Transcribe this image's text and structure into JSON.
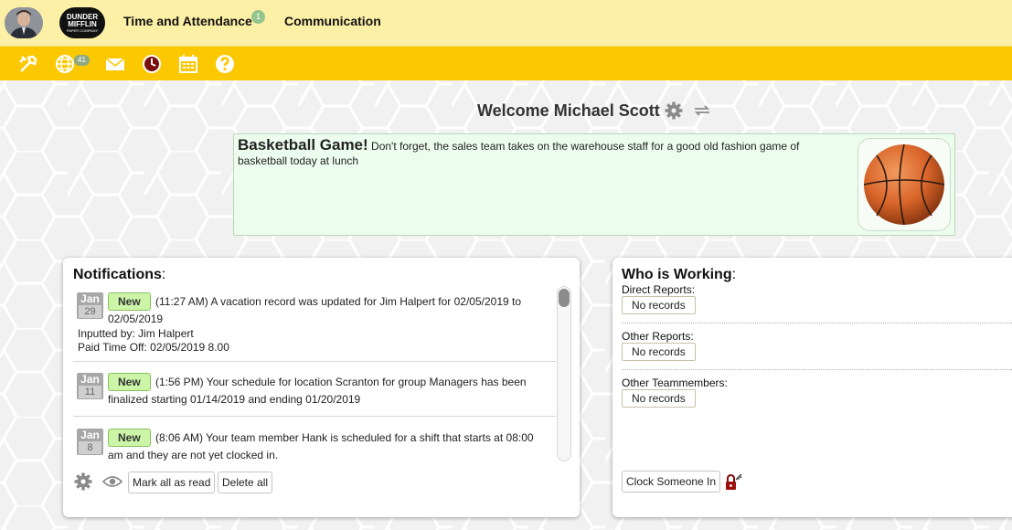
{
  "header": {
    "nav": [
      {
        "label": "Time and Attendance",
        "badge": "1"
      },
      {
        "label": "Communication"
      }
    ],
    "logo_text": [
      "DUNDER",
      "MIFFLIN",
      "PAPER COMPANY"
    ]
  },
  "toolbar": {
    "globe_badge": "41",
    "icons": [
      "wrench-icon",
      "globe-icon",
      "mail-icon",
      "clock-icon",
      "calendar-icon",
      "help-icon"
    ]
  },
  "welcome": {
    "text": "Welcome Michael Scott"
  },
  "announcement": {
    "title": "Basketball Game!",
    "body": " Don't forget, the sales team takes on the warehouse staff for a good old fashion game of basketball today at lunch"
  },
  "notifications": {
    "title": "Notifications",
    "colon": ":",
    "items": [
      {
        "month": "Jan",
        "day": "29",
        "status": "New",
        "line1": "(11:27 AM) A vacation record was updated for Jim Halpert for 02/05/2019 to",
        "line2": "02/05/2019",
        "extra1": "Inputted by: Jim Halpert",
        "extra2": "Paid Time Off: 02/05/2019 8.00"
      },
      {
        "month": "Jan",
        "day": "11",
        "status": "New",
        "line1": "(1:56 PM) Your schedule for location Scranton for group Managers has been",
        "line2": "finalized starting 01/14/2019 and ending 01/20/2019"
      },
      {
        "month": "Jan",
        "day": "8",
        "status": "New",
        "line1": "(8:06 AM) Your team member Hank is scheduled for a shift that starts at 08:00",
        "line2": "am and they are not yet clocked in."
      }
    ],
    "mark_all_read": "Mark all as read",
    "delete_all": "Delete all"
  },
  "who_is_working": {
    "title": "Who is Working",
    "colon": ":",
    "sections": [
      {
        "label": "Direct Reports:",
        "value": "No records"
      },
      {
        "label": "Other Reports:",
        "value": "No records"
      },
      {
        "label": "Other Teammembers:",
        "value": "No records"
      }
    ],
    "clock_in_label": "Clock Someone In"
  },
  "colors": {
    "header_bg": "#fcefa6",
    "toolbar_bg": "#fcc800",
    "announce_bg": "#edfded",
    "new_badge": "#ccf5a8"
  }
}
